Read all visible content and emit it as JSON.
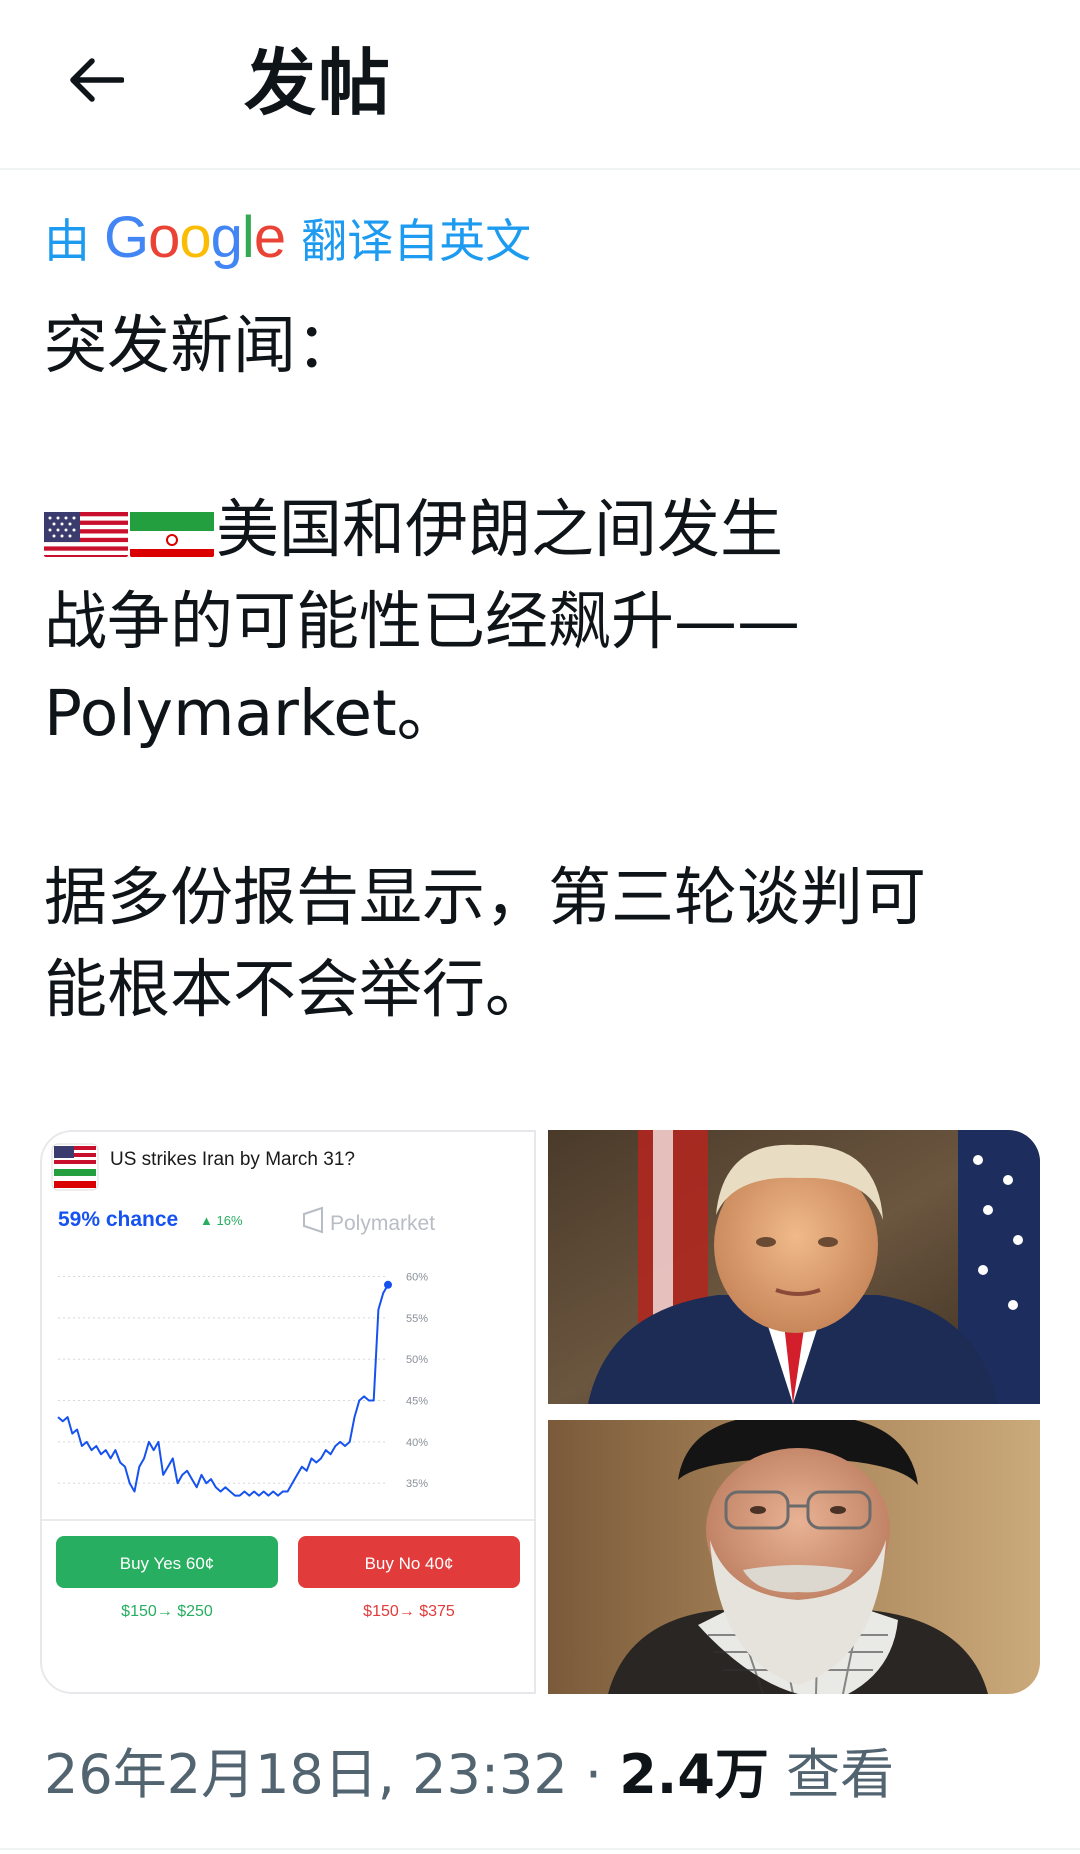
{
  "header": {
    "title": "发帖",
    "back_icon": "arrow-left-icon"
  },
  "translation": {
    "prefix": "由",
    "brand": "Google",
    "suffix": "翻译自英文"
  },
  "post": {
    "line1": "突发新闻：",
    "line2": "美国和伊朗之间发生",
    "line3": "战争的可能性已经飙升——",
    "line4": "Polymarket。",
    "line5": "据多份报告显示，第三轮谈判可",
    "line6": "能根本不会举行。",
    "flags": [
      "us-flag-icon",
      "iran-flag-icon"
    ]
  },
  "media_card": {
    "question": "US strikes Iran by March 31?",
    "chance": "59% chance",
    "change": "▲ 16%",
    "brand": "Polymarket",
    "buy_yes": "Buy Yes 60¢",
    "buy_no": "Buy No 40¢",
    "yes_payout": "$150→ $250",
    "no_payout": "$150→ $375",
    "colors": {
      "accent": "#1652f0",
      "yes": "#27ae60",
      "no": "#e23b3b",
      "up": "#27ae60"
    }
  },
  "chart_data": {
    "type": "line",
    "title": "US strikes Iran by March 31?",
    "ylim": [
      32,
      62
    ],
    "y_ticks": [
      "60%",
      "55%",
      "50%",
      "45%",
      "40%",
      "35%"
    ],
    "y_tick_values": [
      60,
      55,
      50,
      45,
      40,
      35
    ],
    "grid": true,
    "series": [
      {
        "values": [
          43,
          42.5,
          43,
          41,
          41.5,
          39.5,
          40,
          39,
          39.5,
          38.5,
          39,
          38,
          39,
          37.5,
          37,
          35,
          34,
          37,
          38,
          40,
          39,
          40,
          36,
          37,
          38,
          35,
          36,
          36.5,
          35.5,
          34.5,
          36,
          35,
          35.5,
          34.5,
          34,
          34.5,
          34,
          33.5,
          33.5,
          34,
          33.5,
          34,
          33.5,
          34,
          33.5,
          34,
          33.5,
          34,
          34,
          35,
          36,
          37,
          36.5,
          38,
          37.5,
          38,
          39,
          38.5,
          39.5,
          40,
          39.5,
          40,
          43,
          45,
          45.5,
          45,
          45,
          56,
          58,
          59
        ]
      }
    ]
  },
  "footer": {
    "date": "26年2月18日, 23:32 · ",
    "views": "2.4万",
    "views_label": " 查看"
  }
}
